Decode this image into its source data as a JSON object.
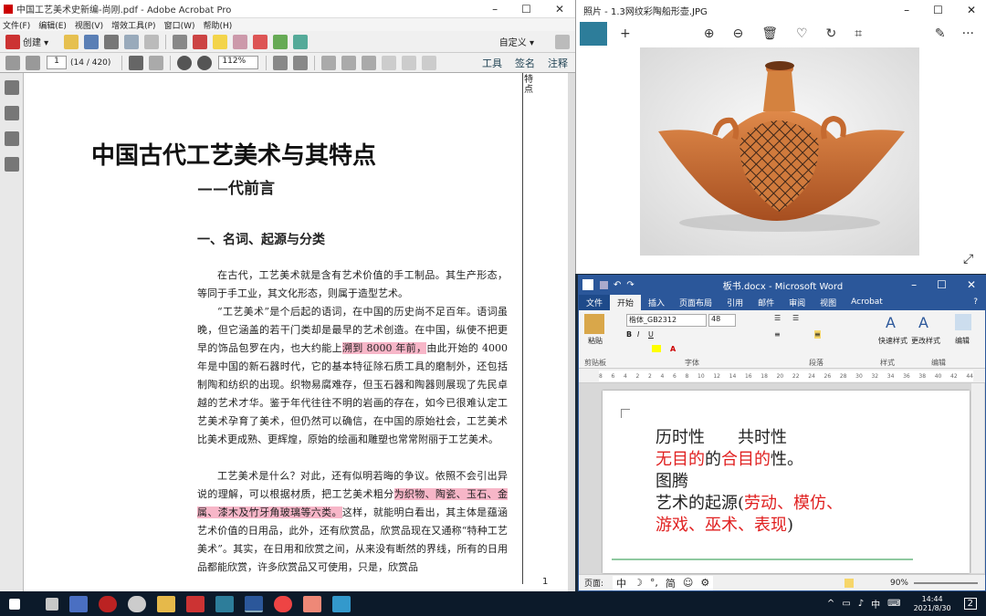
{
  "acrobat": {
    "title": "中国工艺美术史新编-尚刚.pdf - Adobe Acrobat Pro",
    "menu": [
      "文件(F)",
      "编辑(E)",
      "视图(V)",
      "增效工具(P)",
      "窗口(W)",
      "帮助(H)"
    ],
    "create_label": "创建 ▾",
    "custom_label": "自定义 ▾",
    "page_input": "1",
    "page_count": "(14 / 420)",
    "zoom": "112%",
    "right_tabs": [
      "工具",
      "签名",
      "注释"
    ],
    "margin_text": "特点",
    "doc": {
      "title": "中国古代工艺美术与其特点",
      "subtitle": "——代前言",
      "section": "一、名词、起源与分类",
      "p1": "在古代，工艺美术就是含有艺术价值的手工制品。其生产形态，等同于手工业，其文化形态，则属于造型艺术。",
      "p2a": "“工艺美术”是个后起的语词，在中国的历史尚不足百年。语词虽晚，但它涵盖的若干门类却是最早的艺术创造。在中国，纵使不把更早的饰品包罗在内，也大约能上",
      "p2hl": "溯到 8000 年前，",
      "p2b": "由此开始的 4000 年是中国的新石器时代，它的基本特征除石质工具的磨制外，还包括制陶和纺织的出现。织物易腐难存，但玉石器和陶器则展现了先民卓越的艺术才华。鉴于年代往往不明的岩画的存在，如今已很难认定工艺美术孕育了美术，但仍然可以确信，在中国的原始社会，工艺美术比美术更成熟、更辉煌，原始的绘画和雕塑也常常附丽于工艺美术。",
      "p3a": "工艺美术是什么？对此，还有似明若晦的争议。依照不会引出异说的理解，可以根据材质，把工艺美术粗分",
      "p3hl": "为织物、陶瓷、玉石、金属、漆木及竹牙角玻璃等六类。",
      "p3b": "这样，就能明白看出，其主体是蕴涵艺术价值的日用品，此外，还有欣赏品，欣赏品现在又通称“特种工艺美术”。其实，在日用和欣赏之间，从来没有断然的界线，所有的日用品都能欣赏，许多欣赏品又可使用，只是，欣赏品",
      "page_mark": "1"
    }
  },
  "photos": {
    "title": "照片 - 1.3网纹彩陶船形壶.JPG"
  },
  "word": {
    "title": "板书.docx - Microsoft Word",
    "tabs": [
      "文件",
      "开始",
      "插入",
      "页面布局",
      "引用",
      "邮件",
      "审阅",
      "视图",
      "Acrobat"
    ],
    "font_name": "楷体_GB2312",
    "font_size": "48",
    "groups": [
      "剪贴板",
      "字体",
      "段落",
      "样式",
      "编辑"
    ],
    "paste_label": "粘贴",
    "quick_style": "快速样式",
    "change_style": "更改样式",
    "edit_label": "编辑",
    "lines": {
      "l1": "历时性　　共时性",
      "l2_red1": "无目的",
      "l2_mid": "的",
      "l2_red2": "合目的",
      "l2_end": "性。",
      "l3": "图腾",
      "l4a": "艺术的起源(",
      "l4_red": "劳动、模仿、",
      "l5_red": "游戏、巫术、表现",
      "l5_end": ")"
    },
    "status_page": "页面:",
    "status_zoom": "90%",
    "ime": [
      "中",
      "☽",
      "°,",
      "简",
      "☺",
      "⚙"
    ],
    "ruler_ticks": [
      "8",
      "6",
      "4",
      "2",
      "2",
      "4",
      "6",
      "8",
      "10",
      "12",
      "14",
      "16",
      "18",
      "20",
      "22",
      "24",
      "26",
      "28",
      "30",
      "32",
      "34",
      "36",
      "38",
      "40",
      "42",
      "44"
    ]
  },
  "taskbar": {
    "time": "14:44",
    "date": "2021/8/30",
    "ime": "中",
    "notify": "2"
  }
}
